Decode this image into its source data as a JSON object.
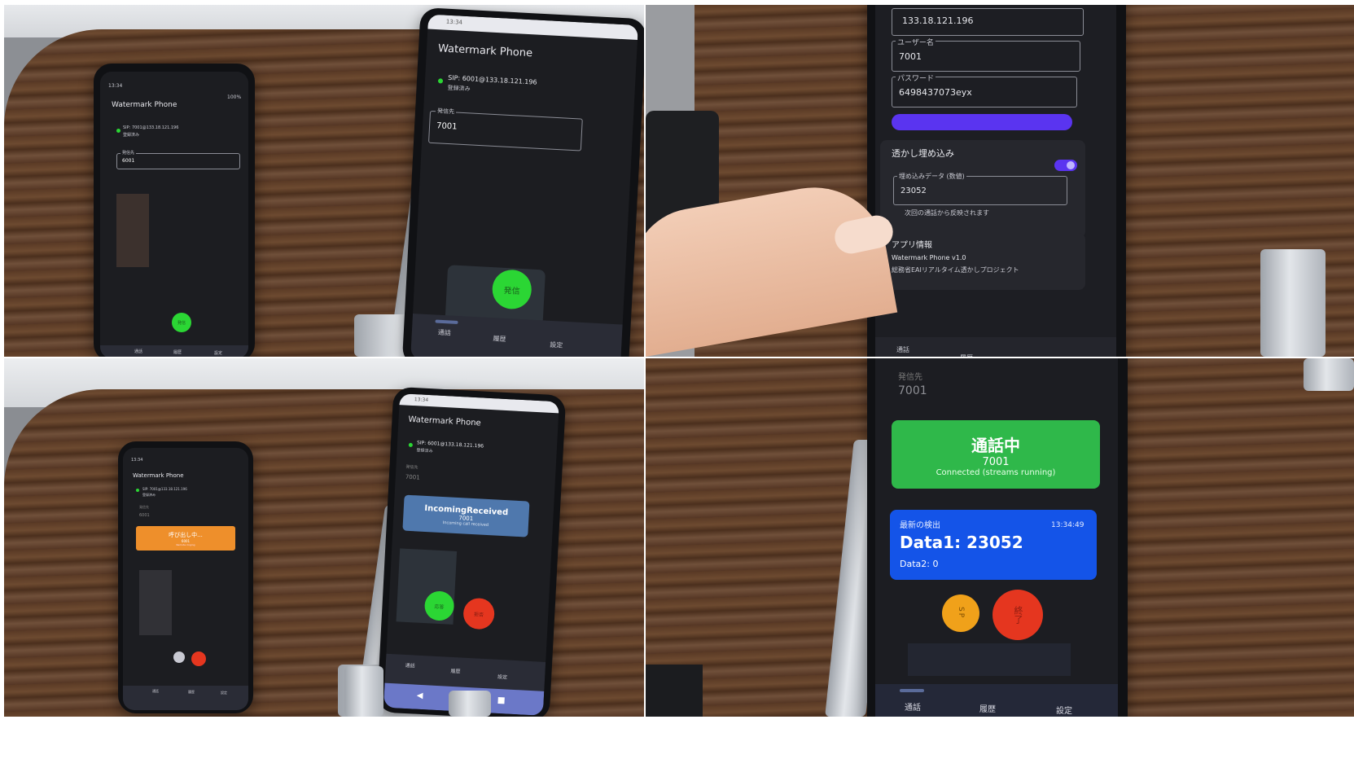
{
  "panels": {
    "top_left": {
      "left_phone": {
        "status_time": "13:34",
        "status_battery": "100%",
        "title": "Watermark Phone",
        "sip": "SIP: 7001@133.18.121.196",
        "registered": "登録済み",
        "dest_label": "発信先",
        "dest_value": "6001",
        "call_button": "発信",
        "nav": [
          "通話",
          "履歴",
          "設定"
        ]
      },
      "right_phone": {
        "status_time": "13:34",
        "title": "Watermark Phone",
        "sip": "SIP: 6001@133.18.121.196",
        "registered": "登録済み",
        "dest_label": "発信先",
        "dest_value": "7001",
        "call_button": "発信",
        "nav": [
          "通話",
          "履歴",
          "設定"
        ]
      }
    },
    "top_right": {
      "server_value": "133.18.121.196",
      "username_label": "ユーザー名",
      "username_value": "7001",
      "password_label": "パスワード",
      "password_value": "6498437073eyx",
      "watermark_section": "透かし埋め込み",
      "embed_label": "埋め込みデータ (数値)",
      "embed_value": "23052",
      "embed_hint": "次回の通話から反映されます",
      "app_info_section": "アプリ情報",
      "app_version": "Watermark Phone v1.0",
      "app_desc": "総務省EAIリアルタイム透かしプロジェクト",
      "nav": [
        "通話",
        "履歴"
      ]
    },
    "bottom_left": {
      "left_phone": {
        "status_time": "13:34",
        "title": "Watermark Phone",
        "sip": "SIP: 7001@133.18.121.196",
        "registered": "登録済み",
        "dest_label": "発信先",
        "dest_value": "6001",
        "calling_title": "呼び出し中...",
        "calling_number": "6001",
        "calling_sub": "Remote ringing",
        "nav": [
          "通話",
          "履歴",
          "設定"
        ]
      },
      "right_phone": {
        "status_time": "13:34",
        "title": "Watermark Phone",
        "sip": "SIP: 6001@133.18.121.196",
        "registered": "登録済み",
        "dest_label": "発信先",
        "dest_value": "7001",
        "incoming_title": "IncomingReceived",
        "incoming_number": "7001",
        "incoming_sub": "Incoming call received",
        "answer_button": "応答",
        "reject_button": "拒否",
        "nav": [
          "通話",
          "履歴",
          "設定"
        ]
      }
    },
    "bottom_right": {
      "dest_label": "発信先",
      "dest_value": "7001",
      "in_call_title": "通話中",
      "in_call_number": "7001",
      "in_call_status": "Connected (streams running)",
      "detect_label": "最新の検出",
      "detect_time": "13:34:49",
      "data1": "Data1: 23052",
      "data2": "Data2: 0",
      "speaker_button": "SP",
      "end_button": "終了",
      "nav": [
        "通話",
        "履歴",
        "設定"
      ]
    }
  },
  "colors": {
    "green_button": "#2bd634",
    "red_button": "#e5361f",
    "orange_card": "#ee8f2b",
    "incoming_card": "#4f78ad",
    "in_call_card": "#2fb84a",
    "detect_card": "#1454e8",
    "sp_button": "#f0a11a",
    "toggle_purple": "#5a34f0"
  }
}
